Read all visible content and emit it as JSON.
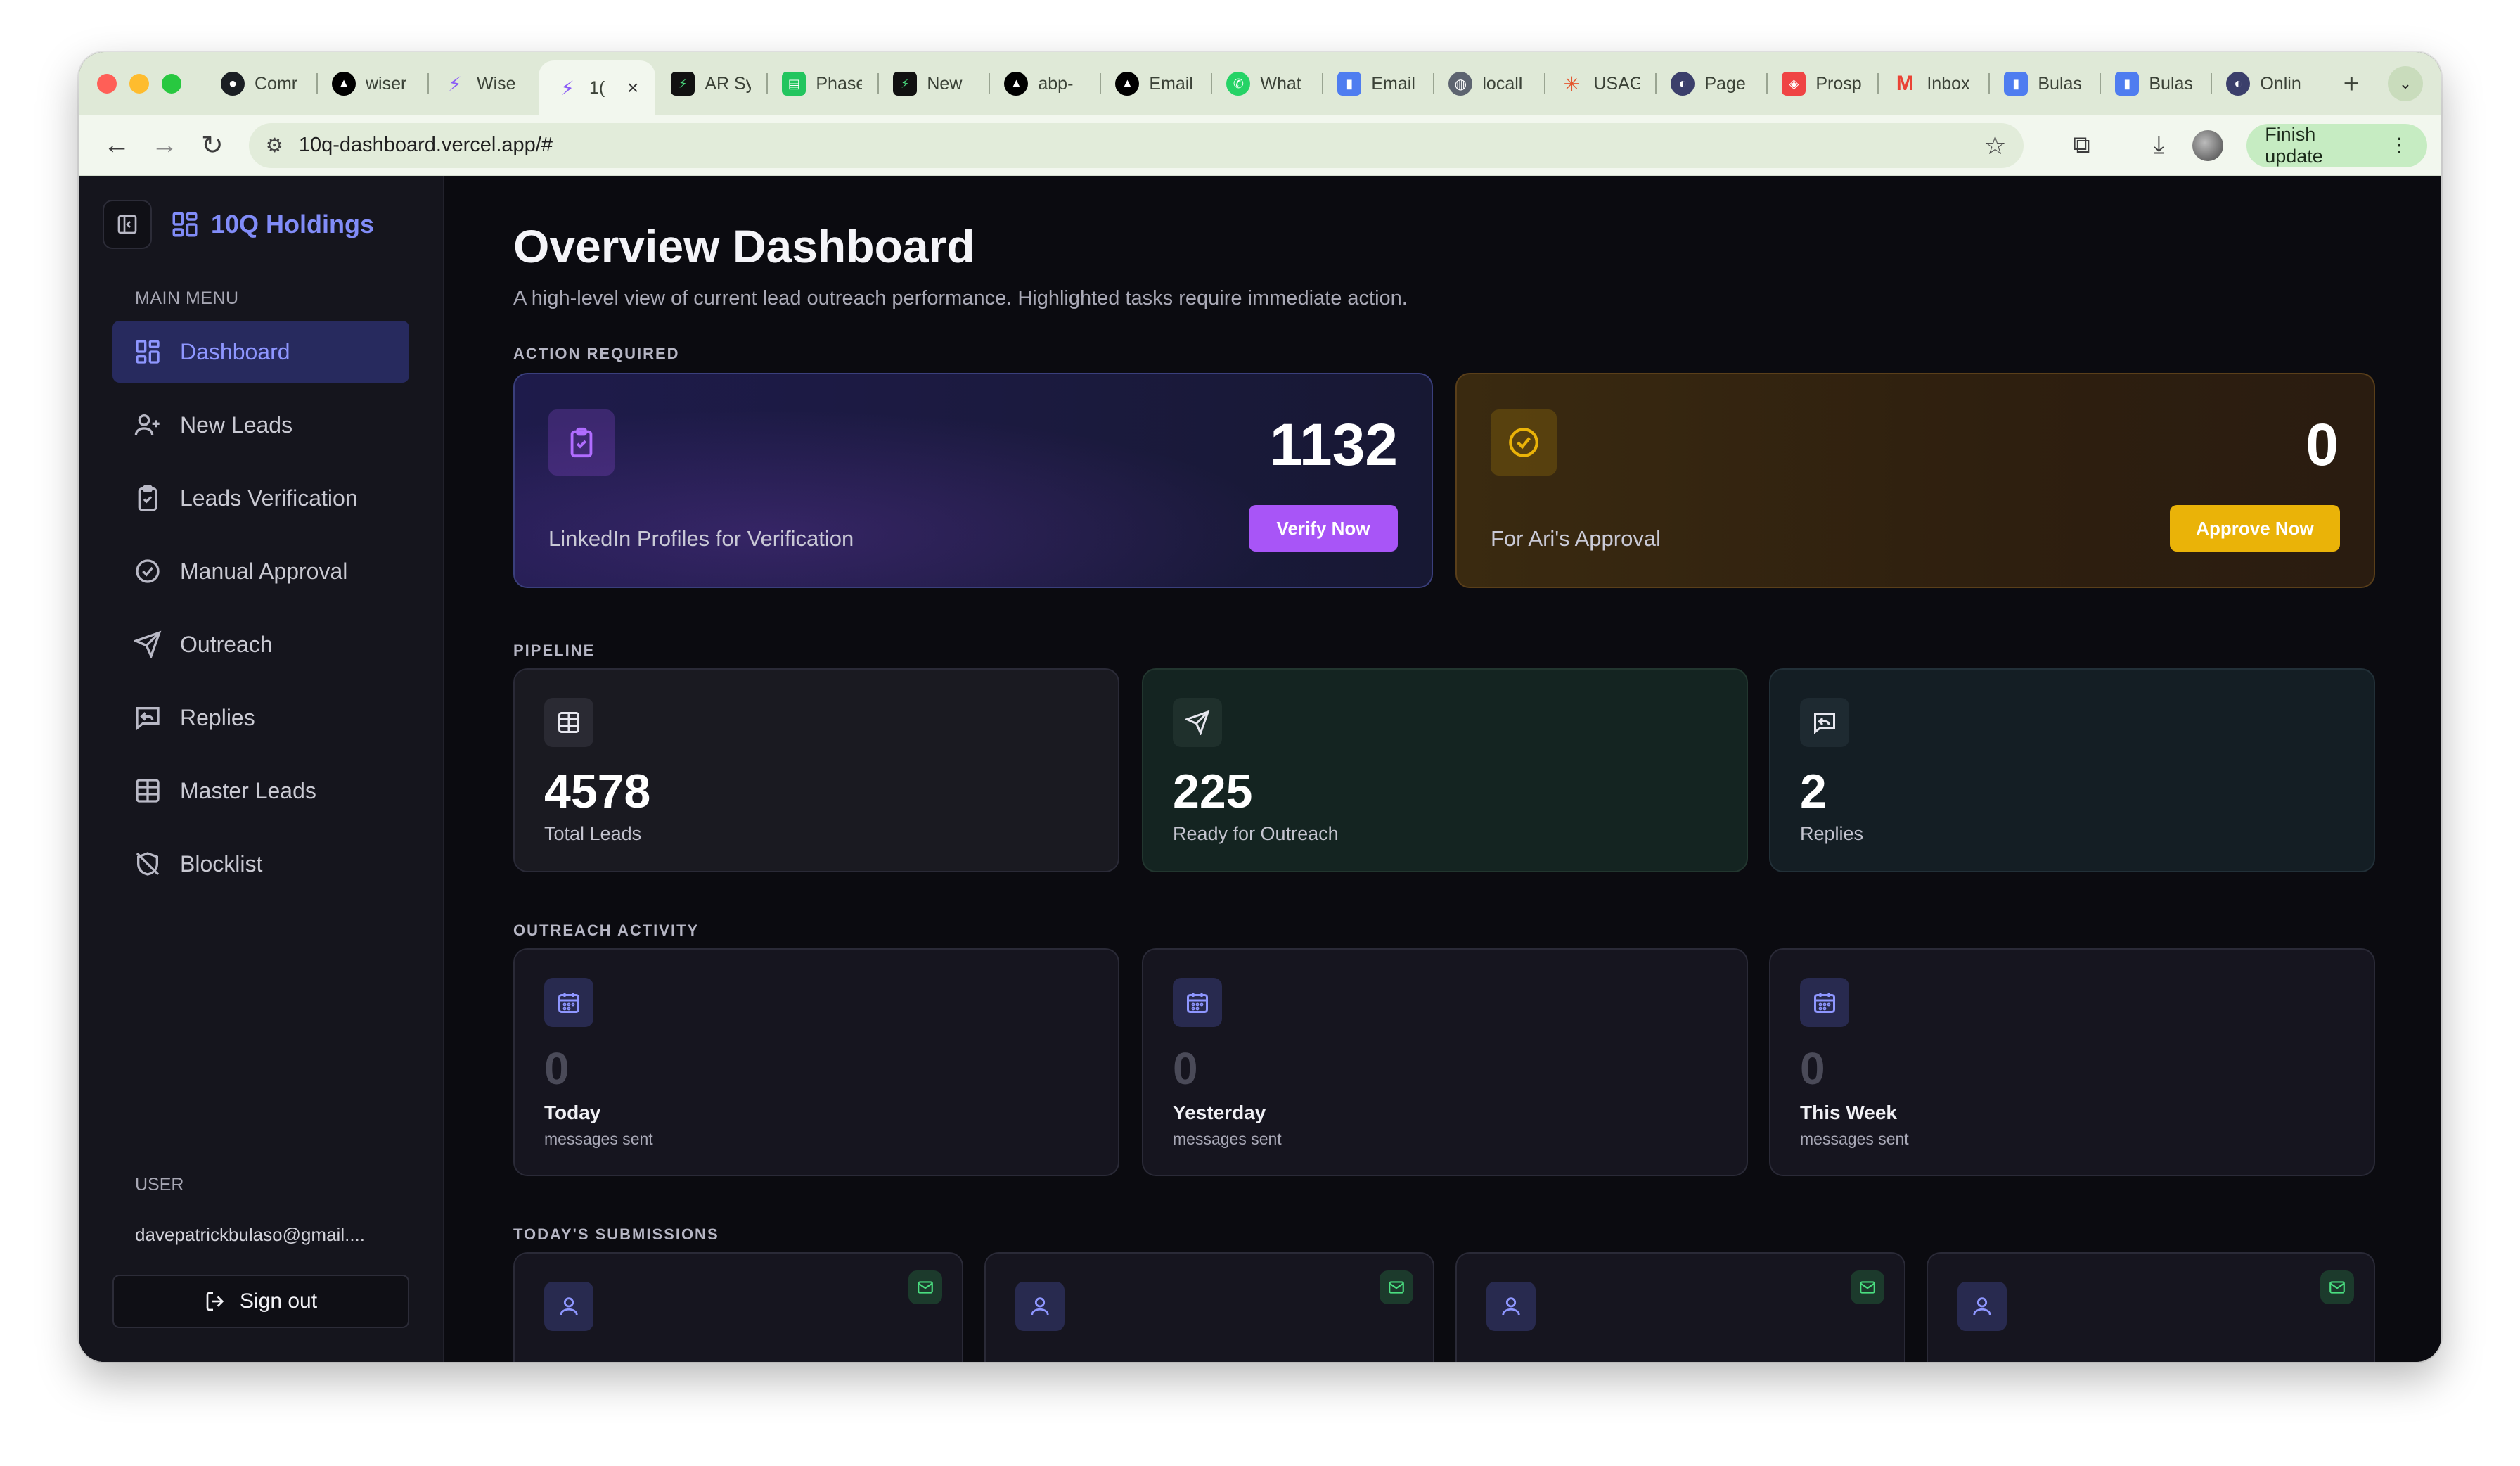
{
  "browser": {
    "tabs": [
      {
        "label": "Comr",
        "icon": "github-icon"
      },
      {
        "label": "wiser",
        "icon": "vercel-icon"
      },
      {
        "label": "Wise",
        "icon": "bolt-icon"
      },
      {
        "label": "1(",
        "icon": "bolt-icon",
        "active": true
      },
      {
        "label": "AR Sy",
        "icon": "terminal-icon"
      },
      {
        "label": "Phase",
        "icon": "sheet-icon"
      },
      {
        "label": "New",
        "icon": "terminal-icon"
      },
      {
        "label": "abp-",
        "icon": "vercel-icon"
      },
      {
        "label": "Email",
        "icon": "vercel-icon"
      },
      {
        "label": "What",
        "icon": "whatsapp-icon"
      },
      {
        "label": "Email",
        "icon": "doc-icon"
      },
      {
        "label": "locall",
        "icon": "globe-icon"
      },
      {
        "label": "USAG",
        "icon": "spark-icon"
      },
      {
        "label": "Page",
        "icon": "swirl-icon"
      },
      {
        "label": "Prosp",
        "icon": "box-icon"
      },
      {
        "label": "Inbox",
        "icon": "gmail-icon"
      },
      {
        "label": "Bulas",
        "icon": "doc-icon"
      },
      {
        "label": "Bulas",
        "icon": "doc-icon"
      },
      {
        "label": "Onlin",
        "icon": "swirl-icon"
      }
    ],
    "url": "10q-dashboard.vercel.app/#",
    "finish_update": "Finish update"
  },
  "sidebar": {
    "brand": "10Q Holdings",
    "menu_heading": "MAIN MENU",
    "items": [
      {
        "label": "Dashboard",
        "icon": "dashboard-icon"
      },
      {
        "label": "New Leads",
        "icon": "user-plus-icon"
      },
      {
        "label": "Leads Verification",
        "icon": "clipboard-check-icon"
      },
      {
        "label": "Manual Approval",
        "icon": "check-circle-icon"
      },
      {
        "label": "Outreach",
        "icon": "send-icon"
      },
      {
        "label": "Replies",
        "icon": "message-reply-icon"
      },
      {
        "label": "Master Leads",
        "icon": "table-icon"
      },
      {
        "label": "Blocklist",
        "icon": "blocked-icon"
      }
    ],
    "user_heading": "USER",
    "user_email": "davepatrickbulaso@gmail....",
    "sign_out": "Sign out"
  },
  "main": {
    "title": "Overview Dashboard",
    "subtitle": "A high-level view of current lead outreach performance. Highlighted tasks require immediate action.",
    "action_required": {
      "label": "ACTION REQUIRED",
      "verification": {
        "count": "1132",
        "label": "LinkedIn Profiles for Verification",
        "button": "Verify Now"
      },
      "approval": {
        "count": "0",
        "label": "For Ari's Approval",
        "button": "Approve Now"
      }
    },
    "pipeline": {
      "label": "PIPELINE",
      "cards": [
        {
          "value": "4578",
          "label": "Total Leads"
        },
        {
          "value": "225",
          "label": "Ready for Outreach"
        },
        {
          "value": "2",
          "label": "Replies"
        }
      ]
    },
    "outreach_activity": {
      "label": "OUTREACH ACTIVITY",
      "cards": [
        {
          "value": "0",
          "period": "Today",
          "sub": "messages sent"
        },
        {
          "value": "0",
          "period": "Yesterday",
          "sub": "messages sent"
        },
        {
          "value": "0",
          "period": "This Week",
          "sub": "messages sent"
        }
      ]
    },
    "submissions": {
      "label": "TODAY'S SUBMISSIONS"
    }
  },
  "colors": {
    "accent": "#818cf8",
    "verify_button": "#a855f7",
    "approve_button": "#eab308",
    "approval_icon": "#eab308"
  }
}
